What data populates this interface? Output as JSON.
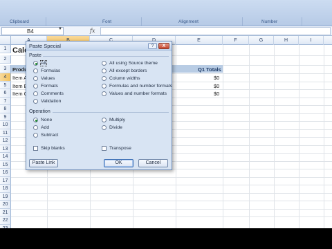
{
  "ribbon": {
    "groups": [
      "Clipboard",
      "Font",
      "Alignment",
      "Number"
    ]
  },
  "formula_bar": {
    "name_box": "B4",
    "fx_label": "fx",
    "formula": ""
  },
  "columns": [
    "A",
    "B",
    "C",
    "D",
    "E",
    "F",
    "G",
    "H",
    "I"
  ],
  "rows": [
    "1",
    "2",
    "3",
    "4",
    "5",
    "6",
    "7",
    "8",
    "9",
    "10",
    "11",
    "12",
    "13",
    "14",
    "15",
    "16",
    "17",
    "18",
    "19",
    "20",
    "21",
    "22",
    "23"
  ],
  "sheet": {
    "title_partial": "Cale",
    "header_partial": "Produ",
    "items_partial": [
      "Item A",
      "Item E",
      "Item C"
    ],
    "totals_header": "Q1 Totals",
    "totals": [
      "$0",
      "$0",
      "$0"
    ]
  },
  "dialog": {
    "title": "Paste Special",
    "help": "?",
    "close": "X",
    "paste_section": "Paste",
    "paste_left": [
      {
        "label": "All",
        "selected": true
      },
      {
        "label": "Formulas",
        "selected": false
      },
      {
        "label": "Values",
        "selected": false
      },
      {
        "label": "Formats",
        "selected": false
      },
      {
        "label": "Comments",
        "selected": false
      },
      {
        "label": "Validation",
        "selected": false
      }
    ],
    "paste_right": [
      {
        "label": "All using Source theme",
        "selected": false
      },
      {
        "label": "All except borders",
        "selected": false
      },
      {
        "label": "Column widths",
        "selected": false
      },
      {
        "label": "Formulas and number formats",
        "selected": false
      },
      {
        "label": "Values and number formats",
        "selected": false
      }
    ],
    "operation_section": "Operation",
    "op_left": [
      {
        "label": "None",
        "selected": true
      },
      {
        "label": "Add",
        "selected": false
      },
      {
        "label": "Subtract",
        "selected": false
      }
    ],
    "op_right": [
      {
        "label": "Multiply",
        "selected": false
      },
      {
        "label": "Divide",
        "selected": false
      }
    ],
    "skip_blanks": "Skip blanks",
    "transpose": "Transpose",
    "paste_link": "Paste Link",
    "ok": "OK",
    "cancel": "Cancel"
  },
  "colors": {
    "accent": "#b8cce4",
    "dialog_bg": "#d8e4f3",
    "selected_header": "#f1c15f"
  }
}
